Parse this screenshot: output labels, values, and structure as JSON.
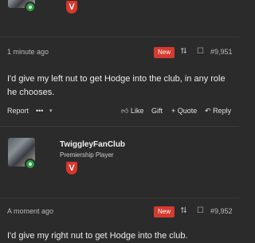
{
  "posts": [
    {
      "username": "",
      "user_title": "",
      "badge": "V",
      "timestamp": "1 minute ago",
      "new_badge": "New",
      "post_number": "#9,951",
      "body": "I'd give my left nut to get Hodge into the club, in any role he chooses.",
      "actions": {
        "report": "Report",
        "more": "•••",
        "like": "Like",
        "gift": "Gift",
        "quote": "Quote",
        "reply": "Reply"
      }
    },
    {
      "username": "TwiggleyFanClub",
      "user_title": "Premiership Player",
      "badge": "V",
      "timestamp": "A moment ago",
      "new_badge": "New",
      "post_number": "#9,952",
      "body": "I'd give my right nut to get Hodge into the club."
    }
  ],
  "colors": {
    "background": "#2b2b2b",
    "new_badge": "#d43a2e",
    "v_badge": "#d9352b",
    "online": "#2f9e44"
  }
}
